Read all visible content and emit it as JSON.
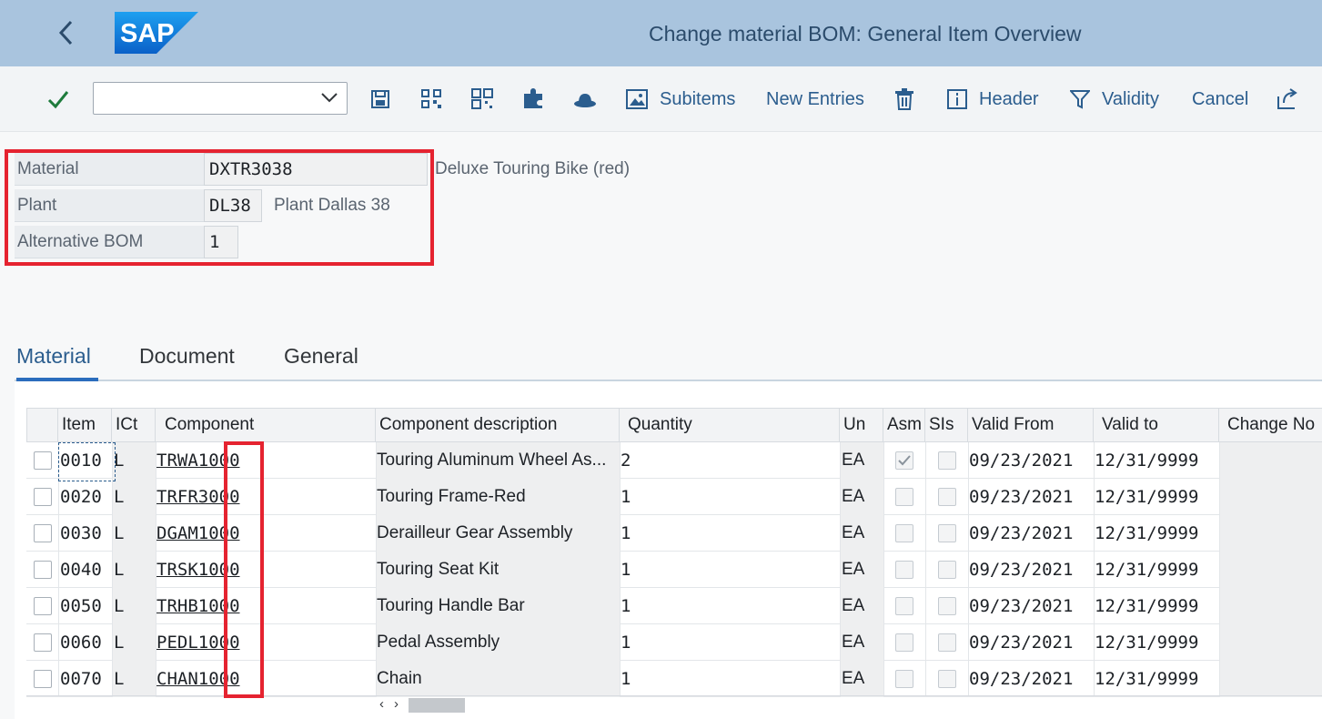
{
  "app": {
    "title": "Change material BOM: General Item Overview",
    "logo_text": "SAP",
    "brand_color": "#0a6ed1"
  },
  "toolbar": {
    "command_field_value": "",
    "buttons": [
      {
        "icon": "checkmark-icon",
        "label": ""
      },
      {
        "icon": "save-icon",
        "label": ""
      },
      {
        "icon": "qr-code-icon",
        "label": ""
      },
      {
        "icon": "barcode-icon",
        "label": ""
      },
      {
        "icon": "puzzle-icon",
        "label": ""
      },
      {
        "icon": "hat-icon",
        "label": ""
      },
      {
        "icon": "image-icon",
        "label": "Subitems"
      },
      {
        "icon": "",
        "label": "New Entries"
      },
      {
        "icon": "trash-icon",
        "label": ""
      },
      {
        "icon": "info-icon",
        "label": "Header"
      },
      {
        "icon": "filter-icon",
        "label": "Validity"
      },
      {
        "icon": "",
        "label": "Cancel"
      },
      {
        "icon": "export-icon",
        "label": ""
      }
    ]
  },
  "header": {
    "material_label": "Material",
    "material_value": "DXTR3038",
    "material_desc": "Deluxe Touring Bike (red)",
    "plant_label": "Plant",
    "plant_value": "DL38",
    "plant_desc": "Plant Dallas 38",
    "altbom_label": "Alternative BOM",
    "altbom_value": "1"
  },
  "tabs": [
    "Material",
    "Document",
    "General"
  ],
  "active_tab": "Material",
  "table": {
    "columns": [
      "Item",
      "ICt",
      "Component",
      "Component description",
      "Quantity",
      "Un",
      "Asm",
      "SIs",
      "Valid From",
      "Valid to",
      "Change No"
    ],
    "rows": [
      {
        "item": "0010",
        "ict": "L",
        "component": "TRWA1000",
        "description": "Touring Aluminum Wheel As...",
        "quantity": "2",
        "un": "EA",
        "asm": true,
        "sls": false,
        "valid_from": "09/23/2021",
        "valid_to": "12/31/9999",
        "change_no": ""
      },
      {
        "item": "0020",
        "ict": "L",
        "component": "TRFR3000",
        "description": "Touring Frame-Red",
        "quantity": "1",
        "un": "EA",
        "asm": false,
        "sls": false,
        "valid_from": "09/23/2021",
        "valid_to": "12/31/9999",
        "change_no": ""
      },
      {
        "item": "0030",
        "ict": "L",
        "component": "DGAM1000",
        "description": "Derailleur Gear Assembly",
        "quantity": "1",
        "un": "EA",
        "asm": false,
        "sls": false,
        "valid_from": "09/23/2021",
        "valid_to": "12/31/9999",
        "change_no": ""
      },
      {
        "item": "0040",
        "ict": "L",
        "component": "TRSK1000",
        "description": "Touring Seat Kit",
        "quantity": "1",
        "un": "EA",
        "asm": false,
        "sls": false,
        "valid_from": "09/23/2021",
        "valid_to": "12/31/9999",
        "change_no": ""
      },
      {
        "item": "0050",
        "ict": "L",
        "component": "TRHB1000",
        "description": "Touring Handle Bar",
        "quantity": "1",
        "un": "EA",
        "asm": false,
        "sls": false,
        "valid_from": "09/23/2021",
        "valid_to": "12/31/9999",
        "change_no": ""
      },
      {
        "item": "0060",
        "ict": "L",
        "component": "PEDL1000",
        "description": "Pedal Assembly",
        "quantity": "1",
        "un": "EA",
        "asm": false,
        "sls": false,
        "valid_from": "09/23/2021",
        "valid_to": "12/31/9999",
        "change_no": ""
      },
      {
        "item": "0070",
        "ict": "L",
        "component": "CHAN1000",
        "description": "Chain",
        "quantity": "1",
        "un": "EA",
        "asm": false,
        "sls": false,
        "valid_from": "09/23/2021",
        "valid_to": "12/31/9999",
        "change_no": ""
      }
    ],
    "scroll_left_arrow": "‹",
    "scroll_right_arrow": "›"
  },
  "annotation_color": "#e52330"
}
